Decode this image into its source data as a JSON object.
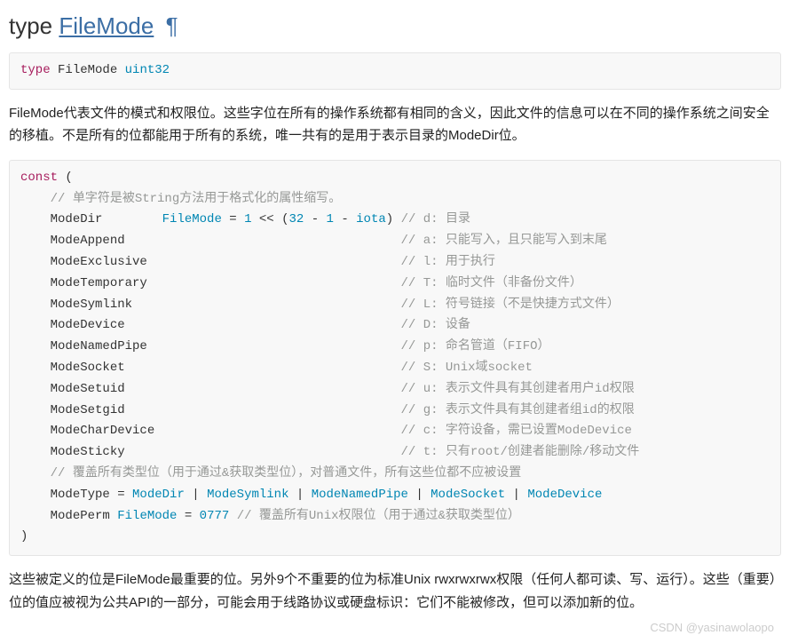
{
  "heading": {
    "kw": "type",
    "name": "FileMode",
    "pilcrow": "¶"
  },
  "typedecl": {
    "full": "type FileMode uint32"
  },
  "para1": "FileMode代表文件的模式和权限位。这些字位在所有的操作系统都有相同的含义，因此文件的信息可以在不同的操作系统之间安全的移植。不是所有的位都能用于所有的系统，唯一共有的是用于表示目录的ModeDir位。",
  "constblock": {
    "lines": [
      {
        "indent": 0,
        "segs": [
          {
            "cls": "kw",
            "t": "const"
          },
          {
            "cls": "id",
            "t": " ("
          }
        ]
      },
      {
        "indent": 1,
        "segs": [
          {
            "cls": "cmt",
            "t": "// 单字符是被String方法用于格式化的属性缩写。"
          }
        ]
      },
      {
        "indent": 1,
        "segs": [
          {
            "cls": "id",
            "t": "ModeDir        "
          },
          {
            "cls": "tp",
            "t": "FileMode"
          },
          {
            "cls": "id",
            "t": " = "
          },
          {
            "cls": "num",
            "t": "1"
          },
          {
            "cls": "id",
            "t": " << ("
          },
          {
            "cls": "num",
            "t": "32"
          },
          {
            "cls": "id",
            "t": " - "
          },
          {
            "cls": "num",
            "t": "1"
          },
          {
            "cls": "id",
            "t": " - "
          },
          {
            "cls": "fn",
            "t": "iota"
          },
          {
            "cls": "id",
            "t": ") "
          },
          {
            "cls": "cmt",
            "t": "// d: 目录"
          }
        ]
      },
      {
        "indent": 1,
        "segs": [
          {
            "cls": "id",
            "t": "ModeAppend                                     "
          },
          {
            "cls": "cmt",
            "t": "// a: 只能写入，且只能写入到末尾"
          }
        ]
      },
      {
        "indent": 1,
        "segs": [
          {
            "cls": "id",
            "t": "ModeExclusive                                  "
          },
          {
            "cls": "cmt",
            "t": "// l: 用于执行"
          }
        ]
      },
      {
        "indent": 1,
        "segs": [
          {
            "cls": "id",
            "t": "ModeTemporary                                  "
          },
          {
            "cls": "cmt",
            "t": "// T: 临时文件（非备份文件）"
          }
        ]
      },
      {
        "indent": 1,
        "segs": [
          {
            "cls": "id",
            "t": "ModeSymlink                                    "
          },
          {
            "cls": "cmt",
            "t": "// L: 符号链接（不是快捷方式文件）"
          }
        ]
      },
      {
        "indent": 1,
        "segs": [
          {
            "cls": "id",
            "t": "ModeDevice                                     "
          },
          {
            "cls": "cmt",
            "t": "// D: 设备"
          }
        ]
      },
      {
        "indent": 1,
        "segs": [
          {
            "cls": "id",
            "t": "ModeNamedPipe                                  "
          },
          {
            "cls": "cmt",
            "t": "// p: 命名管道（FIFO）"
          }
        ]
      },
      {
        "indent": 1,
        "segs": [
          {
            "cls": "id",
            "t": "ModeSocket                                     "
          },
          {
            "cls": "cmt",
            "t": "// S: Unix域socket"
          }
        ]
      },
      {
        "indent": 1,
        "segs": [
          {
            "cls": "id",
            "t": "ModeSetuid                                     "
          },
          {
            "cls": "cmt",
            "t": "// u: 表示文件具有其创建者用户id权限"
          }
        ]
      },
      {
        "indent": 1,
        "segs": [
          {
            "cls": "id",
            "t": "ModeSetgid                                     "
          },
          {
            "cls": "cmt",
            "t": "// g: 表示文件具有其创建者组id的权限"
          }
        ]
      },
      {
        "indent": 1,
        "segs": [
          {
            "cls": "id",
            "t": "ModeCharDevice                                 "
          },
          {
            "cls": "cmt",
            "t": "// c: 字符设备，需已设置ModeDevice"
          }
        ]
      },
      {
        "indent": 1,
        "segs": [
          {
            "cls": "id",
            "t": "ModeSticky                                     "
          },
          {
            "cls": "cmt",
            "t": "// t: 只有root/创建者能删除/移动文件"
          }
        ]
      },
      {
        "indent": 1,
        "segs": [
          {
            "cls": "cmt",
            "t": "// 覆盖所有类型位（用于通过&获取类型位），对普通文件，所有这些位都不应被设置"
          }
        ]
      },
      {
        "indent": 1,
        "segs": [
          {
            "cls": "id",
            "t": "ModeType = "
          },
          {
            "cls": "tp",
            "t": "ModeDir"
          },
          {
            "cls": "id",
            "t": " | "
          },
          {
            "cls": "tp",
            "t": "ModeSymlink"
          },
          {
            "cls": "id",
            "t": " | "
          },
          {
            "cls": "tp",
            "t": "ModeNamedPipe"
          },
          {
            "cls": "id",
            "t": " | "
          },
          {
            "cls": "tp",
            "t": "ModeSocket"
          },
          {
            "cls": "id",
            "t": " | "
          },
          {
            "cls": "tp",
            "t": "ModeDevice"
          }
        ]
      },
      {
        "indent": 1,
        "segs": [
          {
            "cls": "id",
            "t": "ModePerm "
          },
          {
            "cls": "tp",
            "t": "FileMode"
          },
          {
            "cls": "id",
            "t": " = "
          },
          {
            "cls": "num",
            "t": "0777"
          },
          {
            "cls": "id",
            "t": " "
          },
          {
            "cls": "cmt",
            "t": "// 覆盖所有Unix权限位（用于通过&获取类型位）"
          }
        ]
      },
      {
        "indent": 0,
        "segs": [
          {
            "cls": "id",
            "t": ")"
          }
        ]
      }
    ]
  },
  "para2": "这些被定义的位是FileMode最重要的位。另外9个不重要的位为标准Unix rwxrwxrwx权限（任何人都可读、写、运行）。这些（重要）位的值应被视为公共API的一部分，可能会用于线路协议或硬盘标识：它们不能被修改，但可以添加新的位。",
  "watermark": "CSDN @yasinawolaopo"
}
